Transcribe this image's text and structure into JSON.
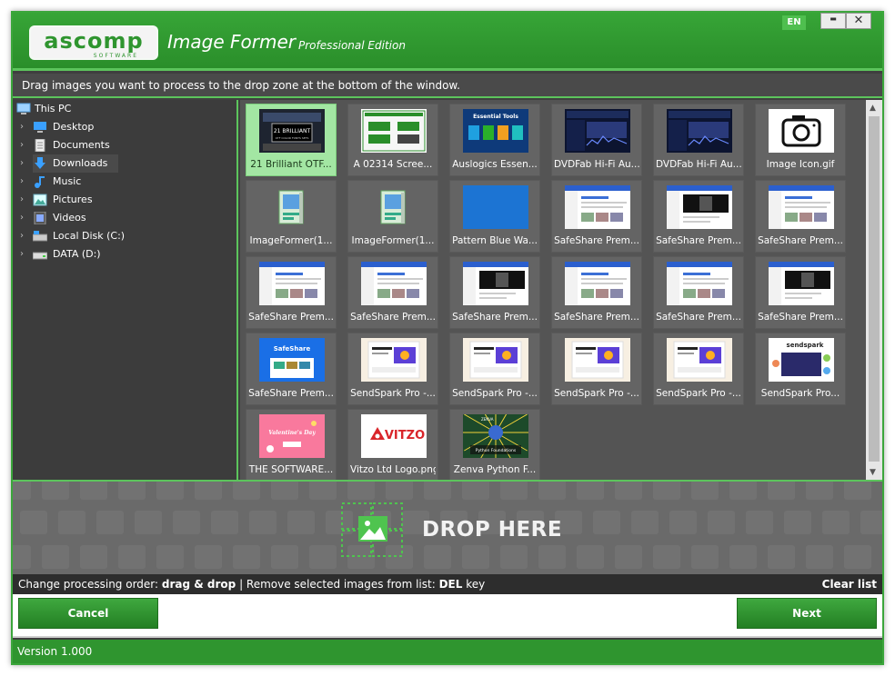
{
  "window": {
    "app_title": "Image Former",
    "edition": "Professional Edition",
    "logo_text": "ascomp",
    "logo_sub": "SOFTWARE",
    "lang": "EN",
    "minimize_glyph": "▬",
    "close_glyph": "✕"
  },
  "instruction": "Drag images you want to process to the drop zone at the bottom of the window.",
  "tree": {
    "root": "This PC",
    "items": [
      {
        "label": "Desktop",
        "icon": "desktop-icon"
      },
      {
        "label": "Documents",
        "icon": "documents-icon"
      },
      {
        "label": "Downloads",
        "icon": "downloads-icon"
      },
      {
        "label": "Music",
        "icon": "music-icon"
      },
      {
        "label": "Pictures",
        "icon": "pictures-icon"
      },
      {
        "label": "Videos",
        "icon": "videos-icon"
      },
      {
        "label": "Local Disk (C:)",
        "icon": "local-disk-icon"
      },
      {
        "label": "DATA (D:)",
        "icon": "data-drive-icon"
      }
    ]
  },
  "thumbnails": [
    {
      "caption": "21 Brilliant OTF...",
      "selected": true
    },
    {
      "caption": "A 02314  Scree..."
    },
    {
      "caption": "Auslogics Essen..."
    },
    {
      "caption": "DVDFab Hi-Fi Au..."
    },
    {
      "caption": "DVDFab Hi-Fi Au..."
    },
    {
      "caption": "Image Icon.gif"
    },
    {
      "caption": "ImageFormer(1..."
    },
    {
      "caption": "ImageFormer(1..."
    },
    {
      "caption": "Pattern Blue Wa..."
    },
    {
      "caption": "SafeShare Prem..."
    },
    {
      "caption": "SafeShare Prem..."
    },
    {
      "caption": "SafeShare Prem..."
    },
    {
      "caption": "SafeShare Prem..."
    },
    {
      "caption": "SafeShare Prem..."
    },
    {
      "caption": "SafeShare Prem..."
    },
    {
      "caption": "SafeShare Prem..."
    },
    {
      "caption": "SafeShare Prem..."
    },
    {
      "caption": "SafeShare Prem..."
    },
    {
      "caption": "SafeShare Prem..."
    },
    {
      "caption": "SendSpark Pro -..."
    },
    {
      "caption": "SendSpark Pro -..."
    },
    {
      "caption": "SendSpark Pro -..."
    },
    {
      "caption": "SendSpark Pro -..."
    },
    {
      "caption": "SendSpark Pro..."
    },
    {
      "caption": "THE SOFTWARE..."
    },
    {
      "caption": "Vitzo Ltd Logo.png"
    },
    {
      "caption": "Zenva Python F..."
    }
  ],
  "thumb_labels": {
    "brilliant_title": "21 BRILLIANT",
    "brilliant_sub": "OTF COLOR FONTS SETS",
    "auslogics_title": "Essential Tools",
    "vitzo": "VITZO",
    "zenva_brand": "ZENVA",
    "zenva_title": "Python Foundations",
    "valentine": "Valentine's Day",
    "safeshare": "SafeShare",
    "sendspark": "sendspark"
  },
  "drop_zone": {
    "label": "DROP HERE"
  },
  "hint": {
    "order_prefix": "Change processing order: ",
    "order_action": "drag & drop",
    "sep": " | ",
    "remove_prefix": "Remove selected images from list: ",
    "remove_key": "DEL",
    "remove_suffix": " key",
    "clear_list": "Clear list"
  },
  "buttons": {
    "cancel": "Cancel",
    "next": "Next"
  },
  "status": {
    "version": "Version 1.000"
  },
  "colors": {
    "accent": "#2f952f",
    "selection": "#a3e6a3"
  }
}
